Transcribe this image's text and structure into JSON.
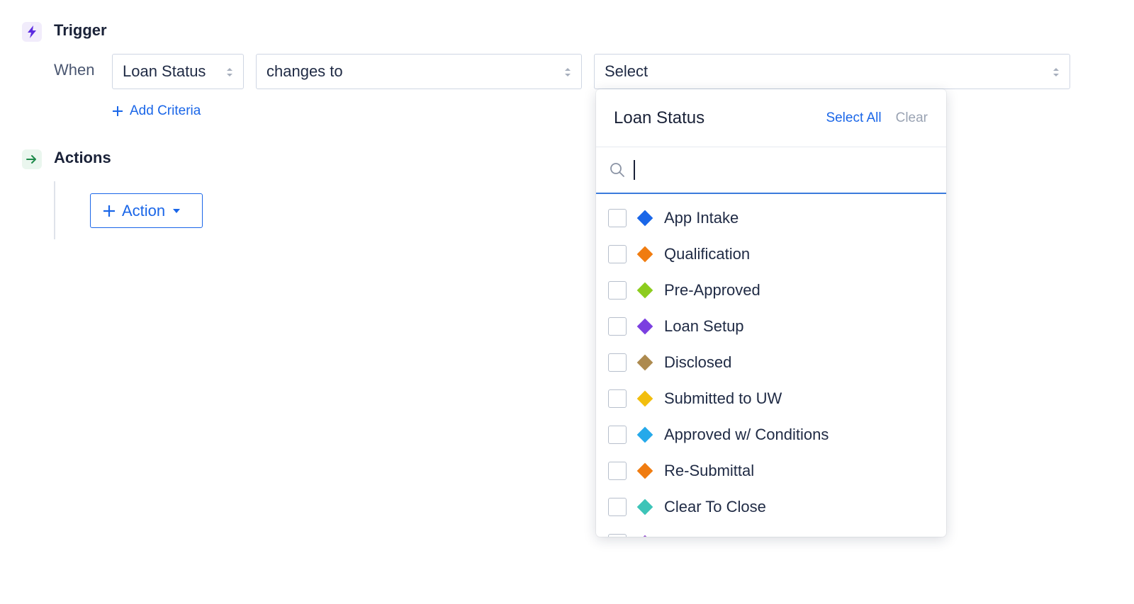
{
  "trigger": {
    "title": "Trigger",
    "when_label": "When",
    "field_select": "Loan Status",
    "operator_select": "changes to",
    "value_select": "Select",
    "add_criteria": "Add Criteria"
  },
  "actions": {
    "title": "Actions",
    "action_button": "Action"
  },
  "dropdown": {
    "title": "Loan Status",
    "select_all": "Select All",
    "clear": "Clear",
    "search_value": "",
    "items": [
      {
        "label": "App Intake",
        "color": "#1a66e8"
      },
      {
        "label": "Qualification",
        "color": "#f07c10"
      },
      {
        "label": "Pre-Approved",
        "color": "#8ccc1e"
      },
      {
        "label": "Loan Setup",
        "color": "#7b3fe0"
      },
      {
        "label": "Disclosed",
        "color": "#ad8a4f"
      },
      {
        "label": "Submitted to UW",
        "color": "#f2be0e"
      },
      {
        "label": "Approved w/ Conditions",
        "color": "#25a9ea"
      },
      {
        "label": "Re-Submittal",
        "color": "#f07c10"
      },
      {
        "label": "Clear To Close",
        "color": "#3dc4b8"
      },
      {
        "label": "",
        "color": "#9b59d0"
      }
    ]
  },
  "colors": {
    "accent": "#1a66e8",
    "trigger_icon": "#5b2be0",
    "actions_icon": "#1e8a4a"
  }
}
